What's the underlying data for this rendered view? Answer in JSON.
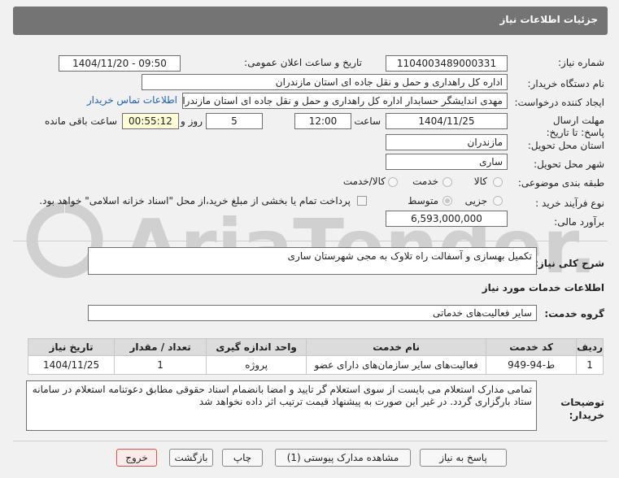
{
  "header": {
    "title": "جزئیات اطلاعات نیاز"
  },
  "watermark": {
    "text": "AriaTender.neT"
  },
  "form": {
    "need_number_label": "شماره نیاز:",
    "need_number": "1104003489000331",
    "announce_label": "تاریخ و ساعت اعلان عمومی:",
    "announce_value": "1404/11/20 - 09:50",
    "buyer_org_label": "نام دستگاه خریدار:",
    "buyer_org": "اداره کل راهداری و حمل و نقل جاده ای استان مازندران",
    "requester_label": "ایجاد کننده درخواست:",
    "requester": "مهدی اندایشگر حسابدار اداره کل راهداری و حمل و نقل جاده ای استان مازندران",
    "buyer_contact_link": "اطلاعات تماس خریدار",
    "deadline_label": "مهلت ارسال پاسخ: تا تاریخ:",
    "deadline_date": "1404/11/25",
    "time_label": "ساعت",
    "deadline_time": "12:00",
    "days_value": "5",
    "days_label": "روز و",
    "remaining_time": "00:55:12",
    "remaining_label": "ساعت باقی مانده",
    "province_label": "استان محل تحویل:",
    "province": "مازندران",
    "city_label": "شهر محل تحویل:",
    "city": "ساری",
    "category_label": "طبقه بندی موضوعی:",
    "category_options": [
      "کالا",
      "خدمت",
      "کالا/خدمت"
    ],
    "process_label": "نوع فرآیند خرید :",
    "process_options": [
      "جزیی",
      "متوسط"
    ],
    "payment_note": "پرداخت تمام یا بخشی از مبلغ خرید،از محل \"اسناد خزانه اسلامی\" خواهد بود.",
    "estimate_label": "برآورد مالی:",
    "estimate": "6,593,000,000"
  },
  "summary": {
    "label": "شرح کلی نیاز:",
    "text": "تکمیل بهسازی و آسفالت راه تلاوک به مجی شهرستان ساری"
  },
  "services": {
    "section_title": "اطلاعات خدمات مورد نیاز",
    "group_label": "گروه خدمت:",
    "group_value": "سایر فعالیت‌های خدماتی",
    "table": {
      "headers": [
        "ردیف",
        "کد خدمت",
        "نام خدمت",
        "واحد اندازه گیری",
        "تعداد / مقدار",
        "تاریخ نیاز"
      ],
      "rows": [
        [
          "1",
          "ط-94-949",
          "فعالیت‌های سایر سازمان‌های دارای عضو",
          "پروژه",
          "1",
          "1404/11/25"
        ]
      ]
    }
  },
  "notes": {
    "label": "توضیحات خریدار:",
    "text": "تمامی مدارک استعلام می بایست از سوی استعلام گر تایید و امضا بانضمام اسناد حقوقی مطابق دعوتنامه استعلام در سامانه ستاد بارگزاری گردد. در غیر این صورت به پیشنهاد قیمت ترتیب اثر داده نخواهد شد"
  },
  "buttons": {
    "reply": "پاسخ به نیاز",
    "attachments": "مشاهده مدارک پیوستی (1)",
    "print": "چاپ",
    "back": "بازگشت",
    "exit": "خروج"
  },
  "colors": {
    "header_bg": "#747474",
    "link": "#1f5fbf",
    "exit_border": "#d9534f"
  }
}
